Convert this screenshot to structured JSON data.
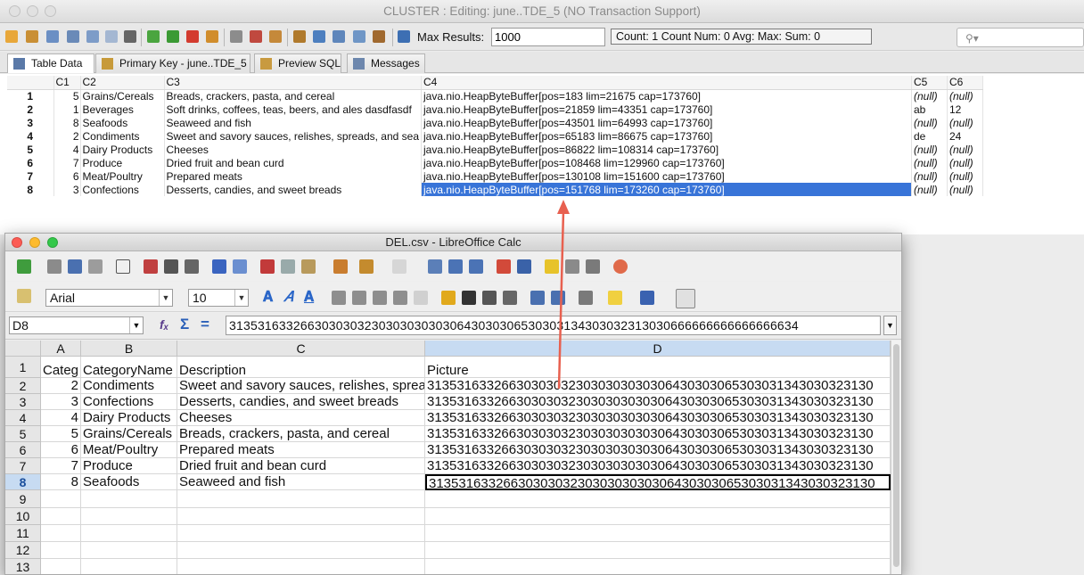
{
  "bg_window": {
    "title": "CLUSTER : Editing: june..TDE_5 (NO Transaction Support)",
    "max_results_label": "Max Results:",
    "max_results_value": "1000",
    "count_summary": "Count: 1  Count Num: 0  Avg:   Max:   Sum: 0",
    "tabs": [
      {
        "label": "Table Data"
      },
      {
        "label": "Primary Key - june..TDE_5"
      },
      {
        "label": "Preview SQL"
      },
      {
        "label": "Messages"
      }
    ],
    "columns": [
      "C1",
      "C2",
      "C3",
      "C4",
      "C5",
      "C6"
    ],
    "rows": [
      {
        "n": "1",
        "c1": "5",
        "c2": "Grains/Cereals",
        "c3": "Breads, crackers, pasta, and cereal",
        "c4": "java.nio.HeapByteBuffer[pos=183 lim=21675 cap=173760]",
        "c5": "(null)",
        "c6": "(null)"
      },
      {
        "n": "2",
        "c1": "1",
        "c2": "Beverages",
        "c3": "Soft drinks, coffees, teas, beers, and ales dasdfasdf",
        "c4": "java.nio.HeapByteBuffer[pos=21859 lim=43351 cap=173760]",
        "c5": "ab",
        "c6": "12"
      },
      {
        "n": "3",
        "c1": "8",
        "c2": "Seafoods",
        "c3": "Seaweed and fish",
        "c4": "java.nio.HeapByteBuffer[pos=43501 lim=64993 cap=173760]",
        "c5": "(null)",
        "c6": "(null)"
      },
      {
        "n": "4",
        "c1": "2",
        "c2": "Condiments",
        "c3": "Sweet and savory sauces, relishes, spreads, and sea",
        "c4": "java.nio.HeapByteBuffer[pos=65183 lim=86675 cap=173760]",
        "c5": "de",
        "c6": "24"
      },
      {
        "n": "5",
        "c1": "4",
        "c2": "Dairy Products",
        "c3": "Cheeses",
        "c4": "java.nio.HeapByteBuffer[pos=86822 lim=108314 cap=173760]",
        "c5": "(null)",
        "c6": "(null)"
      },
      {
        "n": "6",
        "c1": "7",
        "c2": "Produce",
        "c3": "Dried fruit and bean curd",
        "c4": "java.nio.HeapByteBuffer[pos=108468 lim=129960 cap=173760]",
        "c5": "(null)",
        "c6": "(null)"
      },
      {
        "n": "7",
        "c1": "6",
        "c2": "Meat/Poultry",
        "c3": "Prepared meats",
        "c4": "java.nio.HeapByteBuffer[pos=130108 lim=151600 cap=173760]",
        "c5": "(null)",
        "c6": "(null)"
      },
      {
        "n": "8",
        "c1": "3",
        "c2": "Confections",
        "c3": "Desserts, candies, and sweet breads",
        "c4": "java.nio.HeapByteBuffer[pos=151768 lim=173260 cap=173760]",
        "c5": "(null)",
        "c6": "(null)"
      }
    ]
  },
  "calc": {
    "title": "DEL.csv - LibreOffice Calc",
    "font_name": "Arial",
    "font_size": "10",
    "name_box": "D8",
    "formula": "31353163326630303032303030303030643030306530303134303032313030666666666666666634",
    "col_headers": [
      "A",
      "B",
      "C",
      "D"
    ],
    "row_numbers": [
      "1",
      "2",
      "3",
      "4",
      "5",
      "6",
      "7",
      "8",
      "9",
      "10",
      "11",
      "12",
      "13"
    ],
    "header_row": {
      "a": "Categ",
      "b": "CategoryName",
      "c": "Description",
      "d": "Picture"
    },
    "rows": [
      {
        "a": "2",
        "b": "Condiments",
        "c": "Sweet and savory sauces, relishes, spreads",
        "d": "313531633266303030323030303030306430303065303031343030323130"
      },
      {
        "a": "3",
        "b": "Confections",
        "c": "Desserts, candies, and sweet breads",
        "d": "313531633266303030323030303030306430303065303031343030323130"
      },
      {
        "a": "4",
        "b": "Dairy Products",
        "c": "Cheeses",
        "d": "313531633266303030323030303030306430303065303031343030323130"
      },
      {
        "a": "5",
        "b": "Grains/Cereals",
        "c": "Breads, crackers, pasta, and cereal",
        "d": "313531633266303030323030303030306430303065303031343030323130"
      },
      {
        "a": "6",
        "b": "Meat/Poultry",
        "c": "Prepared meats",
        "d": "313531633266303030323030303030306430303065303031343030323130"
      },
      {
        "a": "7",
        "b": "Produce",
        "c": "Dried fruit and bean curd",
        "d": "313531633266303030323030303030306430303065303031343030323130"
      },
      {
        "a": "8",
        "b": "Seafoods",
        "c": "Seaweed and fish",
        "d": "313531633266303030323030303030306430303065303031343030323130"
      }
    ]
  },
  "colors": {
    "selection": "#3874d8",
    "arrow": "#e8604f",
    "close": "#fc5c55",
    "minimize": "#fdbb2e",
    "zoom": "#34c84a"
  }
}
